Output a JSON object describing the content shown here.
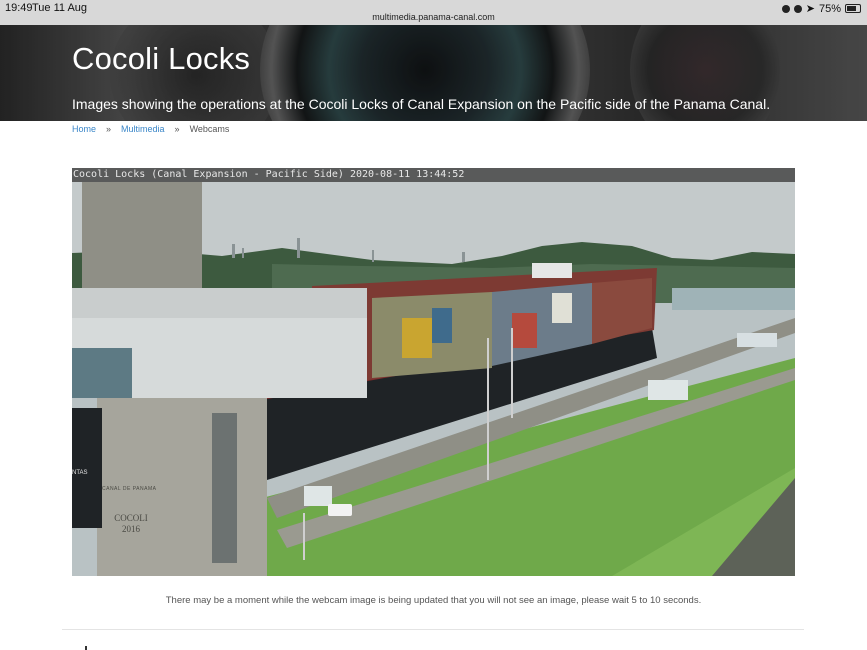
{
  "status_bar": {
    "time": "19:49",
    "date": "Tue 11 Aug",
    "url": "multimedia.panama-canal.com",
    "battery": "75%"
  },
  "hero": {
    "title": "Cocoli Locks",
    "subtitle": "Images showing the operations at the Cocoli Locks of Canal Expansion on the Pacific side of the Panama Canal."
  },
  "breadcrumb": {
    "items": [
      "Home",
      "Multimedia",
      "Webcams"
    ],
    "separator": "»"
  },
  "webcam": {
    "timestamp": "Cocoli Locks (Canal Expansion - Pacific Side) 2020-08-11 13:44:52",
    "tower_text": "COCOLI 2016",
    "tower_brand": "CANAL DE PANAMA",
    "ship_text": "NTAS"
  },
  "caption": "There may be a moment while the webcam image is being updated that you will not see an image, please wait 5 to 10 seconds.",
  "colors": {
    "link": "#3a86c8",
    "grass": "#6fa94a",
    "hull": "#1f2326"
  }
}
